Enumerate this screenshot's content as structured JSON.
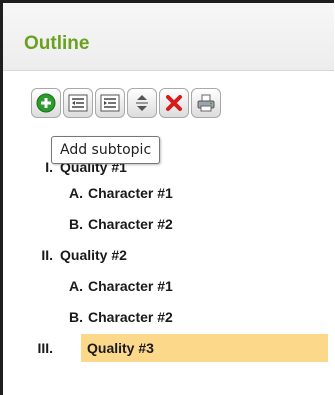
{
  "panel": {
    "title": "Outline"
  },
  "toolbar": {
    "buttons": [
      {
        "name": "add-subtopic",
        "icon": "plus-circle-icon"
      },
      {
        "name": "outdent",
        "icon": "outdent-icon"
      },
      {
        "name": "indent",
        "icon": "indent-icon"
      },
      {
        "name": "move",
        "icon": "up-down-arrows-icon"
      },
      {
        "name": "delete",
        "icon": "red-x-icon"
      },
      {
        "name": "print",
        "icon": "printer-icon"
      }
    ],
    "tooltip": "Add subtopic"
  },
  "outline": {
    "items": [
      {
        "num": "I.",
        "label": "Quality #1",
        "level": 1
      },
      {
        "num": "A.",
        "label": "Character #1",
        "level": 2
      },
      {
        "num": "B.",
        "label": "Character #2",
        "level": 2
      },
      {
        "num": "II.",
        "label": "Quality #2",
        "level": 1
      },
      {
        "num": "A.",
        "label": "Character #1",
        "level": 2
      },
      {
        "num": "B.",
        "label": "Character #2",
        "level": 2
      },
      {
        "num": "III.",
        "label": "Quality #3",
        "level": 1,
        "selected": true
      }
    ]
  },
  "colors": {
    "title": "#6aa21f",
    "selection": "#fcd98a",
    "add": "#2e9b2e",
    "delete": "#d81b1b"
  }
}
